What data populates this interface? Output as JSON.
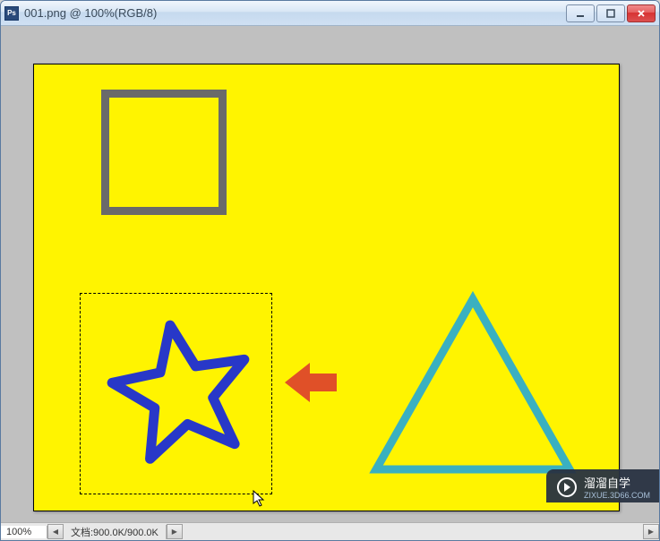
{
  "window": {
    "title": "001.png @ 100%(RGB/8)",
    "app_icon_label": "Ps"
  },
  "controls": {
    "minimize": "—",
    "maximize": "☐",
    "close": "✕"
  },
  "canvas": {
    "background_color": "#fff400",
    "shapes": {
      "square": {
        "stroke": "#6a6a6a"
      },
      "star": {
        "stroke": "#2838c8"
      },
      "triangle": {
        "stroke": "#3ab0c0"
      },
      "arrow": {
        "fill": "#e05028"
      }
    }
  },
  "statusbar": {
    "zoom": "100%",
    "doc_label": "文档:900.0K/900.0K"
  },
  "watermark": {
    "brand": "溜溜自学",
    "sub": "ZIXUE.3D66.COM"
  }
}
